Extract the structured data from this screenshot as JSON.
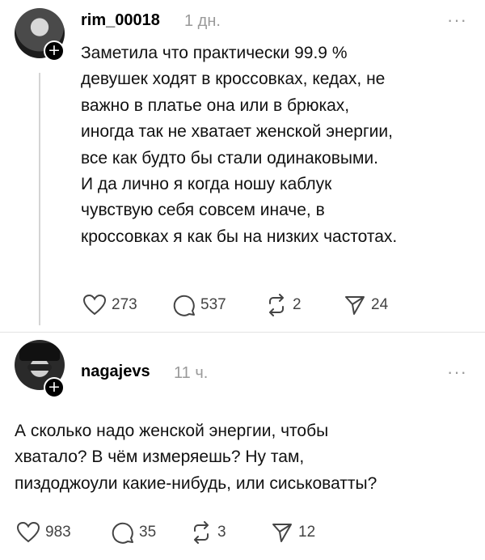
{
  "posts": [
    {
      "username": "rim_00018",
      "time": "1 дн.",
      "text": "Заметила что практически 99.9 %\nдевушек ходят в кроссовках, кедах, не\nважно в платье она или в брюках,\nиногда так не хватает женской энергии,\nвсе как будто бы стали одинаковыми.\nИ да лично я когда ношу каблук\nчувствую себя совсем иначе, в\nкроссовках я как бы на низких частотах.",
      "likes": "273",
      "comments": "537",
      "reposts": "2",
      "shares": "24"
    },
    {
      "username": "nagajevs",
      "time": "11 ч.",
      "text": "А сколько надо женской энергии, чтобы\nхватало? В чём измеряешь? Ну там,\nпиздоджоули какие-нибудь, или сиськоватты?",
      "likes": "983",
      "comments": "35",
      "reposts": "3",
      "shares": "12"
    }
  ],
  "icons": {
    "follow": "plus-icon",
    "more": "more-icon",
    "like": "heart-icon",
    "comment": "comment-icon",
    "repost": "repost-icon",
    "share": "share-icon"
  },
  "more_glyph": "···",
  "plus_glyph": "+"
}
